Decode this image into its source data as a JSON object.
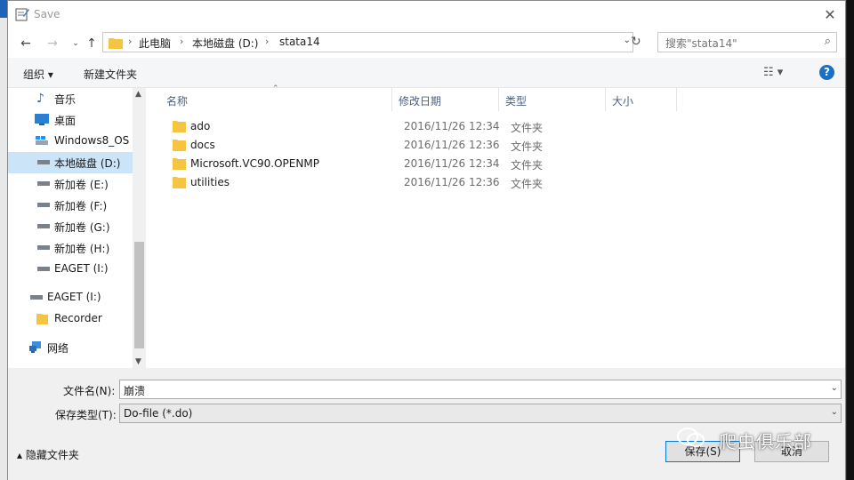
{
  "window": {
    "title": "Save"
  },
  "address": {
    "crumbs": [
      "此电脑",
      "本地磁盘 (D:)",
      "stata14"
    ]
  },
  "search": {
    "placeholder": "搜索\"stata14\""
  },
  "toolbar": {
    "organize_label": "组织 ▾",
    "new_folder_label": "新建文件夹"
  },
  "nav": {
    "items": [
      {
        "label": "音乐",
        "icon": "music-icon"
      },
      {
        "label": "桌面",
        "icon": "desktop-icon"
      },
      {
        "label": "Windows8_OS",
        "icon": "windows-drive-icon"
      },
      {
        "label": "本地磁盘 (D:)",
        "icon": "drive-icon",
        "selected": true
      },
      {
        "label": "新加卷 (E:)",
        "icon": "drive-icon"
      },
      {
        "label": "新加卷 (F:)",
        "icon": "drive-icon"
      },
      {
        "label": "新加卷 (G:)",
        "icon": "drive-icon"
      },
      {
        "label": "新加卷 (H:)",
        "icon": "drive-icon"
      },
      {
        "label": "EAGET (I:)",
        "icon": "drive-icon"
      },
      {
        "label": "EAGET (I:)",
        "icon": "drive-icon"
      },
      {
        "label": "Recorder",
        "icon": "folder-icon"
      },
      {
        "label": "网络",
        "icon": "network-icon"
      }
    ]
  },
  "columns": {
    "name": "名称",
    "date": "修改日期",
    "type": "类型",
    "size": "大小"
  },
  "files": [
    {
      "name": "ado",
      "date": "2016/11/26 12:34",
      "type": "文件夹"
    },
    {
      "name": "docs",
      "date": "2016/11/26 12:36",
      "type": "文件夹"
    },
    {
      "name": "Microsoft.VC90.OPENMP",
      "date": "2016/11/26 12:34",
      "type": "文件夹"
    },
    {
      "name": "utilities",
      "date": "2016/11/26 12:36",
      "type": "文件夹"
    }
  ],
  "form": {
    "filename_label": "文件名(N):",
    "filename_value": "崩溃",
    "filetype_label": "保存类型(T):",
    "filetype_value": "Do-file (*.do)",
    "hide_folders_label": "隐藏文件夹",
    "save_label": "保存(S)",
    "cancel_label": "取消"
  },
  "watermark": {
    "text": "爬虫俱乐部"
  },
  "colors": {
    "accent": "#0078d7",
    "selection": "#cce4f7",
    "folder": "#f5c542",
    "help": "#1a6fc9"
  }
}
